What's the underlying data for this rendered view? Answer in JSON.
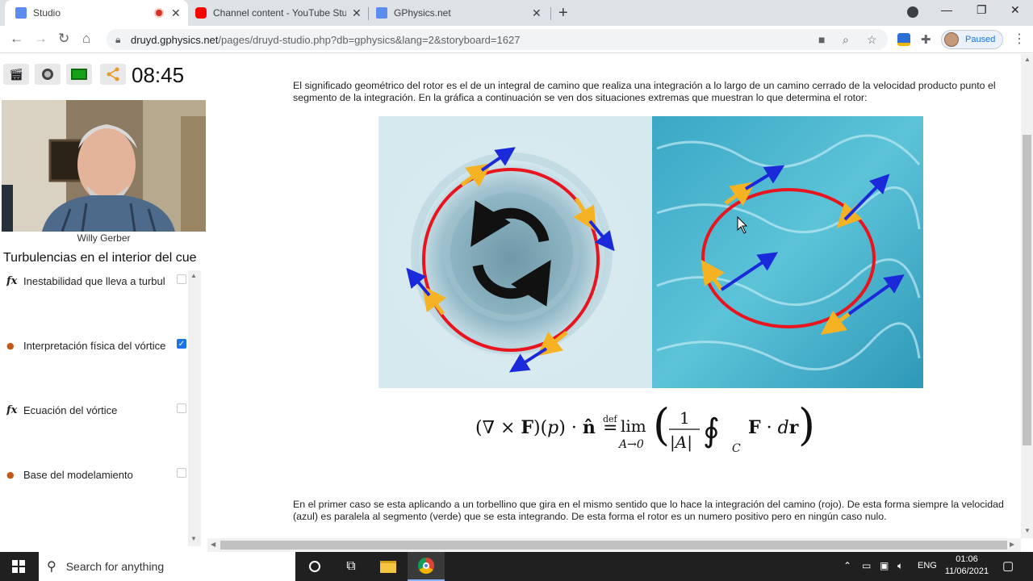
{
  "browser": {
    "tabs": [
      {
        "title": "Studio",
        "active": true
      },
      {
        "title": "Channel content - YouTube Studio",
        "active": false
      },
      {
        "title": "GPhysics.net",
        "active": false
      }
    ],
    "url_domain": "druyd.gphysics.net",
    "url_path": "/pages/druyd-studio.php?db=gphysics&lang=2&storyboard=1627",
    "profile_status": "Paused"
  },
  "sidebar": {
    "timer": "08:45",
    "presenter_name": "Willy Gerber",
    "section_title": "Turbulencias en el interior del cue",
    "items": [
      {
        "label": "Inestabilidad que lleva a turbul",
        "icon": "fx",
        "checked": false
      },
      {
        "label": "Interpretación física del vórtice",
        "icon": "model",
        "checked": true
      },
      {
        "label": "Ecuación del vórtice",
        "icon": "fx",
        "checked": false
      },
      {
        "label": "Base del modelamiento",
        "icon": "model",
        "checked": false
      }
    ]
  },
  "content": {
    "paragraph_1": "El significado geométrico del rotor es el de un integral de camino que realiza una integración a lo largo de un camino cerrado de la velocidad producto punto el segmento de la integración. En la gráfica a continuación se ven dos situaciones extremas que muestran lo que determina el rotor:",
    "paragraph_2": "En el primer caso se esta aplicando a un torbellino que gira en el mismo sentido que lo hace la integración del camino (rojo). De esta forma siempre la velocidad (azul) es paralela al segmento (verde) que se esta integrando. De esta forma el rotor es un numero positivo pero en ningún caso nulo."
  },
  "taskbar": {
    "search_placeholder": "Search for anything",
    "language": "ENG",
    "time": "01:06",
    "date": "11/06/2021"
  },
  "colors": {
    "accent": "#1a73e8",
    "path": "#e8141e",
    "velocity": "#1a2adb",
    "segment": "#f5b324"
  }
}
